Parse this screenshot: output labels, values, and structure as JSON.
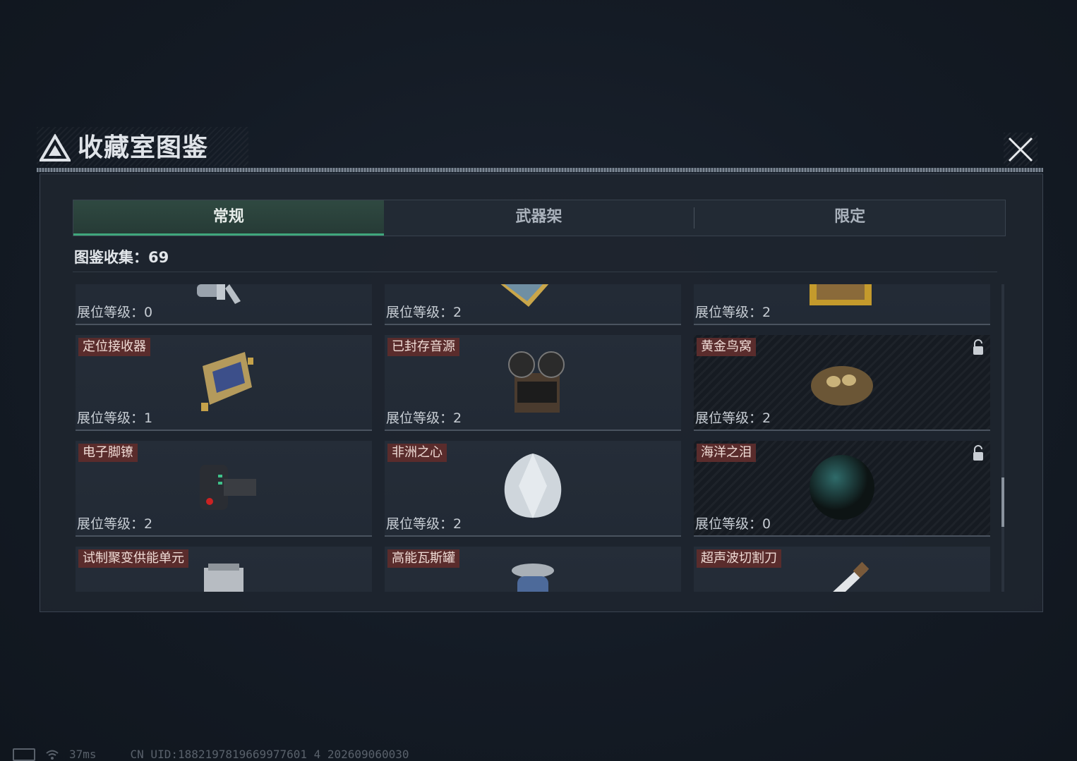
{
  "window": {
    "title": "收藏室图鉴"
  },
  "tabs": [
    {
      "label": "常规",
      "active": true
    },
    {
      "label": "武器架",
      "active": false
    },
    {
      "label": "限定",
      "active": false
    }
  ],
  "collection": {
    "label": "图鉴收集：",
    "count": "69"
  },
  "cards": [
    {
      "name": "",
      "level": "展位等级：0",
      "icon": "flashlight-icon",
      "locked": false
    },
    {
      "name": "",
      "level": "展位等级：2",
      "icon": "map-scroll-icon",
      "locked": false
    },
    {
      "name": "",
      "level": "展位等级：2",
      "icon": "framed-painting-icon",
      "locked": false
    },
    {
      "name": "定位接收器",
      "level": "展位等级：1",
      "icon": "receiver-device-icon",
      "locked": false
    },
    {
      "name": "已封存音源",
      "level": "展位等级：2",
      "icon": "reel-tape-recorder-icon",
      "locked": false
    },
    {
      "name": "黄金鸟窝",
      "level": "展位等级：2",
      "icon": "golden-nest-icon",
      "locked": true
    },
    {
      "name": "电子脚镣",
      "level": "展位等级：2",
      "icon": "ankle-monitor-icon",
      "locked": false
    },
    {
      "name": "非洲之心",
      "level": "展位等级：2",
      "icon": "diamond-icon",
      "locked": false
    },
    {
      "name": "海洋之泪",
      "level": "展位等级：0",
      "icon": "black-pearl-icon",
      "locked": true
    },
    {
      "name": "试制聚变供能单元",
      "level": "",
      "icon": "fusion-cell-icon",
      "locked": false
    },
    {
      "name": "高能瓦斯罐",
      "level": "",
      "icon": "gas-canister-icon",
      "locked": false
    },
    {
      "name": "超声波切割刀",
      "level": "",
      "icon": "ultrasonic-cutter-icon",
      "locked": false
    }
  ],
  "status": {
    "ping": "37ms",
    "uid": "CN UID:1882197819669977601 4 202609060030"
  },
  "colors": {
    "accent": "#3fa77c",
    "name_tag": "#5a2c2c",
    "panel": "#1e252f"
  }
}
